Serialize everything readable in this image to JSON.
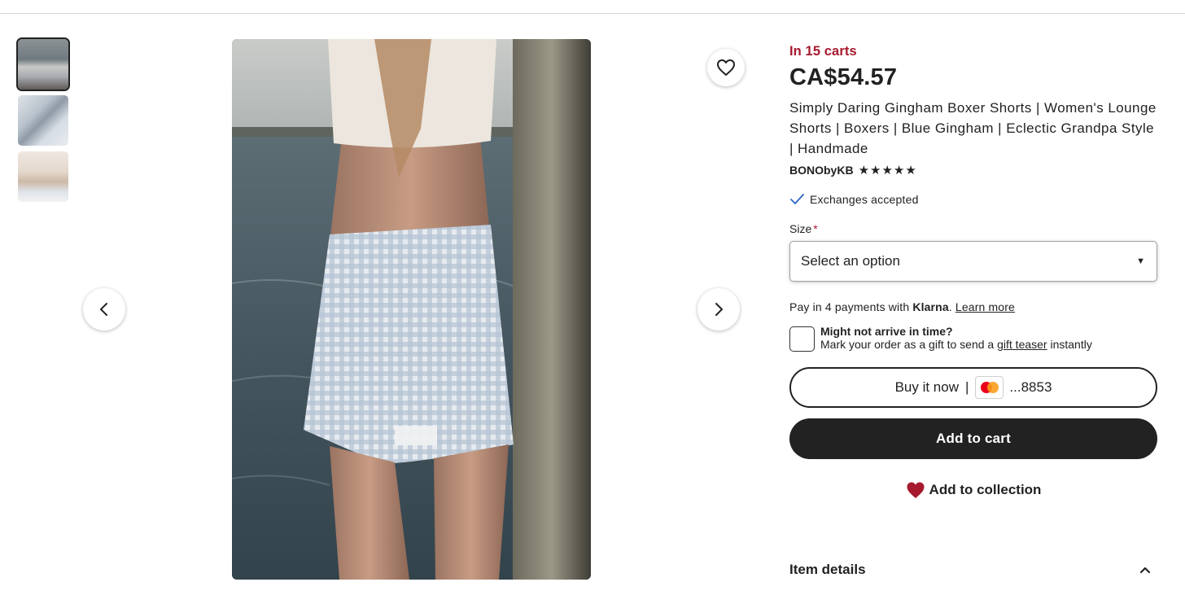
{
  "product": {
    "in_carts": "In 15 carts",
    "price": "CA$54.57",
    "title": "Simply Daring Gingham Boxer Shorts | Women's Lounge Shorts | Boxers | Blue Gingham | Eclectic Grandpa Style | Handmade",
    "shop_name": "BONObyKB",
    "rating_stars": 5,
    "exchanges": "Exchanges accepted"
  },
  "size": {
    "label": "Size",
    "required_mark": "*",
    "selected": "Select an option"
  },
  "klarna": {
    "prefix": "Pay in 4 payments with ",
    "brand": "Klarna",
    "suffix": ". ",
    "link": "Learn more"
  },
  "gift": {
    "heading": "Might not arrive in time?",
    "prefix": "Mark your order as a gift to send a ",
    "link": "gift teaser",
    "suffix": " instantly"
  },
  "buttons": {
    "buy_now": "Buy it now",
    "separator": "|",
    "card_last4": "...8853",
    "add_to_cart": "Add to cart",
    "add_to_collection": "Add to collection"
  },
  "sections": {
    "item_details": "Item details"
  },
  "gallery": {
    "thumbnail_count": 3,
    "active_index": 0,
    "icons": [
      "chevron-left-icon",
      "chevron-right-icon",
      "heart-outline-icon"
    ]
  },
  "colors": {
    "accent_red": "#a61a2e",
    "text": "#222222",
    "button_dark": "#222222",
    "heart_fill": "#a61a2e",
    "check_blue": "#2f66c4"
  }
}
